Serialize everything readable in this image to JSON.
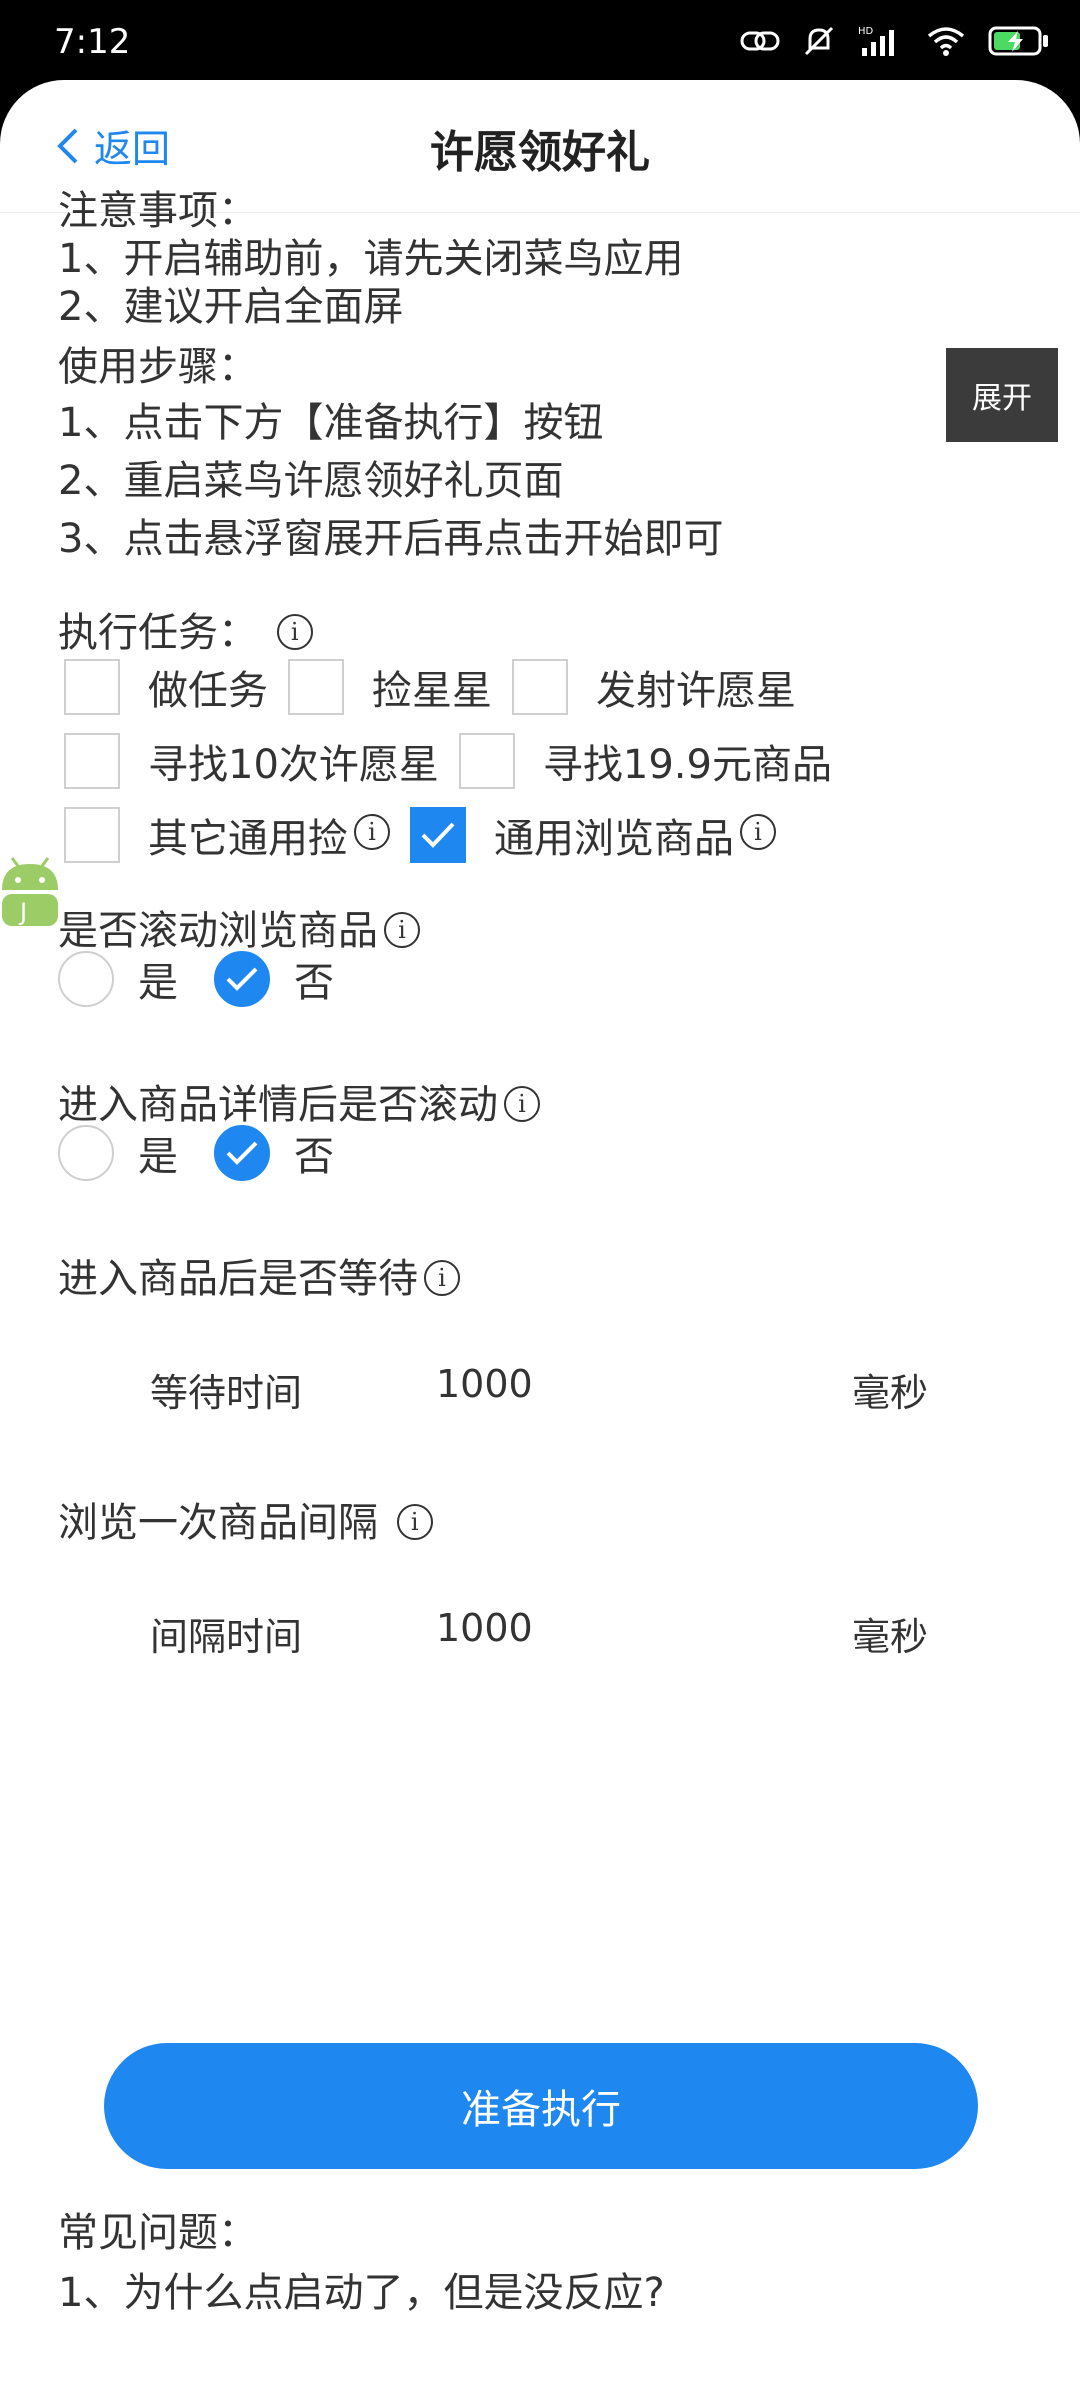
{
  "status": {
    "time": "7:12"
  },
  "nav": {
    "back_label": "返回",
    "title": "许愿领好礼"
  },
  "floating": {
    "expand_label": "展开"
  },
  "notes": {
    "heading": "注意事项：",
    "items": [
      "1、开启辅助前，请先关闭菜鸟应用",
      "2、建议开启全面屏"
    ]
  },
  "steps": {
    "heading": "使用步骤：",
    "items": [
      "1、点击下方【准备执行】按钮",
      "2、重启菜鸟许愿领好礼页面",
      "3、点击悬浮窗展开后再点击开始即可"
    ]
  },
  "tasks": {
    "heading": "执行任务：",
    "options": [
      {
        "label": "做任务",
        "checked": false,
        "info": false
      },
      {
        "label": "捡星星",
        "checked": false,
        "info": false
      },
      {
        "label": "发射许愿星",
        "checked": false,
        "info": false
      },
      {
        "label": "寻找10次许愿星",
        "checked": false,
        "info": false
      },
      {
        "label": "寻找19.9元商品",
        "checked": false,
        "info": false
      },
      {
        "label": "其它通用捡",
        "checked": false,
        "info": true
      },
      {
        "label": "通用浏览商品",
        "checked": true,
        "info": true
      }
    ]
  },
  "scroll_browse": {
    "question": "是否滚动浏览商品",
    "yes": "是",
    "no": "否",
    "selected": "否"
  },
  "scroll_detail": {
    "question": "进入商品详情后是否滚动",
    "yes": "是",
    "no": "否",
    "selected": "否"
  },
  "wait": {
    "question": "进入商品后是否等待",
    "label": "等待时间",
    "value": "1000",
    "unit": "毫秒"
  },
  "interval": {
    "question": "浏览一次商品间隔",
    "label": "间隔时间",
    "value": "1000",
    "unit": "毫秒"
  },
  "action": {
    "button_label": "准备执行"
  },
  "faq": {
    "heading": "常见问题：",
    "first_item": "1、为什么点启动了，但是没反应?"
  },
  "colors": {
    "accent": "#1e88f0",
    "floating_bg": "#3b3b3b"
  }
}
